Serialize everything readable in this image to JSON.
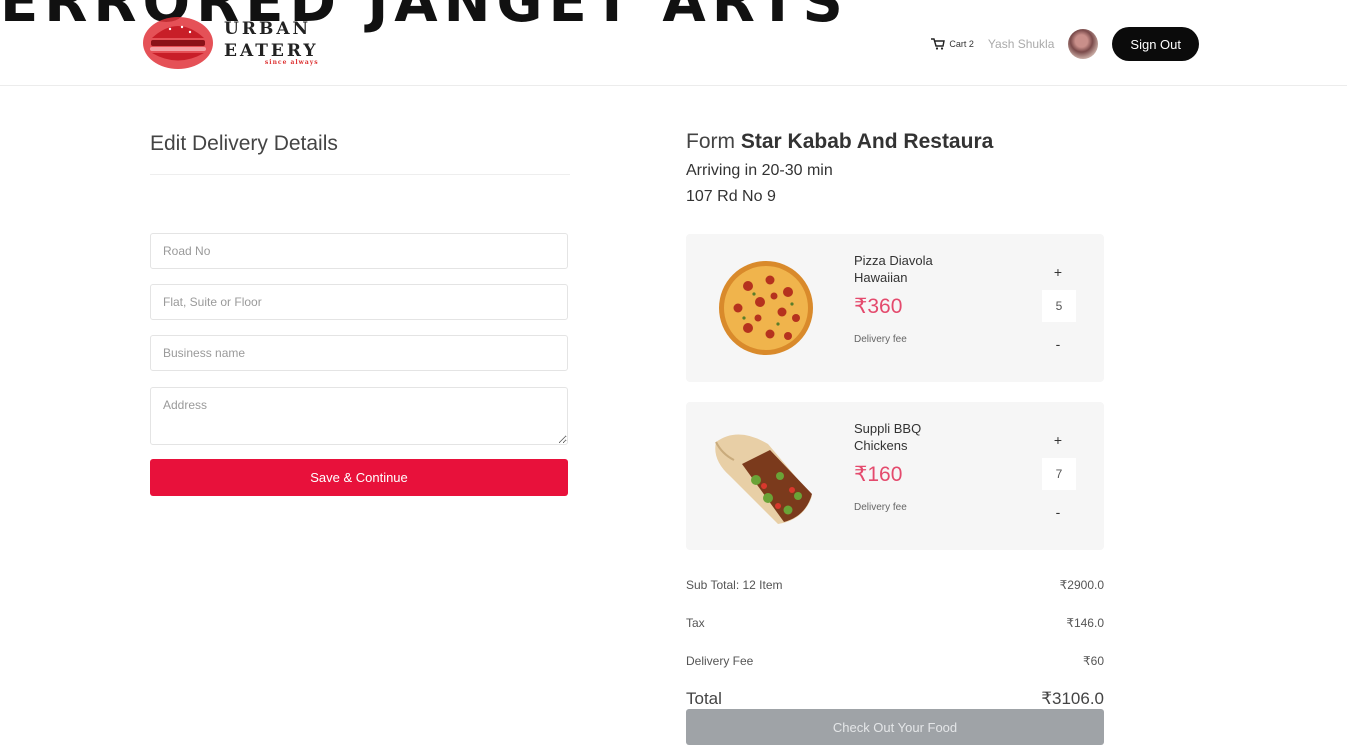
{
  "overlay_title": "ERRORED JANGET ARTS",
  "brand": {
    "line1": "URBAN",
    "line2": "EATERY",
    "tagline": "since always"
  },
  "nav": {
    "cart_label": "Cart 2",
    "user_name": "Yash Shukla",
    "signout_label": "Sign Out"
  },
  "delivery_form": {
    "title": "Edit Delivery Details",
    "road_placeholder": "Road No",
    "flat_placeholder": "Flat, Suite or Floor",
    "business_placeholder": "Business name",
    "address_placeholder": "Address",
    "save_label": "Save & Continue"
  },
  "order": {
    "from_label": "Form",
    "restaurant": "Star Kabab And Restaura",
    "arriving": "Arriving in 20-30 min",
    "address": "107 Rd No 9",
    "items": [
      {
        "name": "Pizza Diavola Hawaiian",
        "price": "₹360",
        "delivery_fee_label": "Delivery fee",
        "qty": "5",
        "plus": "+",
        "minus": "-"
      },
      {
        "name": "Suppli BBQ Chickens",
        "price": "₹160",
        "delivery_fee_label": "Delivery fee",
        "qty": "7",
        "plus": "+",
        "minus": "-"
      }
    ],
    "summary": {
      "subtotal_label": "Sub Total: 12 Item",
      "subtotal_value": "₹2900.0",
      "tax_label": "Tax",
      "tax_value": "₹146.0",
      "delivery_label": "Delivery Fee",
      "delivery_value": "₹60",
      "total_label": "Total",
      "total_value": "₹3106.0"
    },
    "checkout_label": "Check Out Your Food"
  },
  "colors": {
    "brand_red": "#e8113b",
    "price_pink": "#e44a6d",
    "signout_bg": "#0b0b0b",
    "checkout_disabled": "#9fa3a7"
  }
}
